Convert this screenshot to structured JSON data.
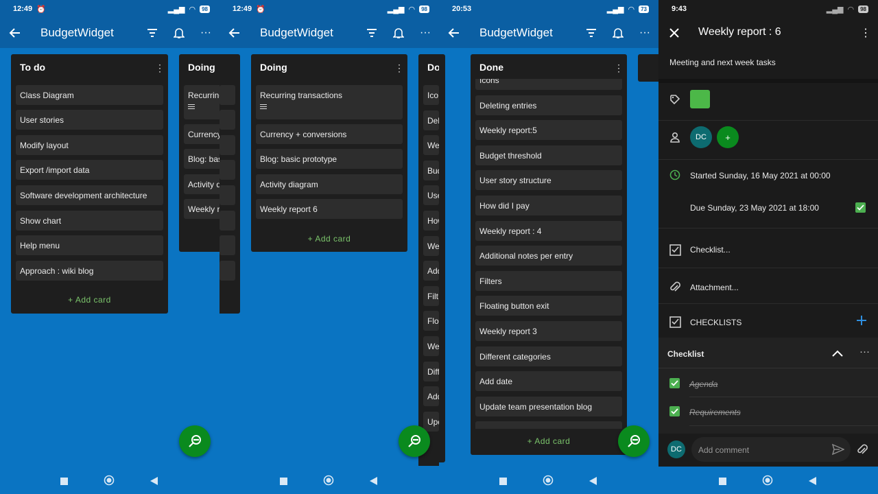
{
  "screens": [
    {
      "status": {
        "time": "12:49",
        "battery": "98"
      },
      "app_title": "BudgetWidget",
      "lists": {
        "todo": {
          "title": "To do",
          "cards": [
            "Class Diagram",
            "User stories",
            "Modify layout",
            "Export /import data",
            "Software development architecture",
            "Show chart",
            "Help menu",
            "Approach : wiki blog"
          ],
          "add_label": "+ Add card"
        },
        "doing_peek": {
          "title": "Doing",
          "cards": [
            "Recurring",
            "Currency",
            "Blog: bas",
            "Activity d",
            "Weekly re"
          ]
        }
      }
    },
    {
      "status": {
        "time": "12:49",
        "battery": "98"
      },
      "app_title": "BudgetWidget",
      "lists": {
        "doing": {
          "title": "Doing",
          "cards": [
            "Recurring transactions",
            "Currency + conversions",
            "Blog: basic prototype",
            "Activity diagram",
            "Weekly report 6"
          ],
          "add_label": "+ Add card"
        },
        "done_peek": {
          "title": "Do",
          "cards": [
            "Ico",
            "Del",
            "We",
            "Bud",
            "Use",
            "How",
            "We",
            "Add",
            "Filt",
            "Flo",
            "We",
            "Diff",
            "Add",
            "Upd"
          ]
        }
      }
    },
    {
      "status": {
        "time": "20:53",
        "battery": "73"
      },
      "app_title": "BudgetWidget",
      "lists": {
        "done": {
          "title": "Done",
          "cards": [
            "Icons",
            "Deleting entries",
            "Weekly report:5",
            "Budget threshold",
            "User story structure",
            "How did I pay",
            "Weekly report : 4",
            "Additional notes per entry",
            "Filters",
            "Floating button exit",
            "Weekly report 3",
            "Different categories",
            "Add date",
            "Update team presentation blog"
          ],
          "add_label": "+ Add card"
        }
      }
    },
    {
      "status": {
        "time": "9:43",
        "battery": "98"
      },
      "title": "Weekly report : 6",
      "description": "Meeting and next week tasks",
      "label_color": "#4CB848",
      "members": [
        "DC"
      ],
      "add_member": "+",
      "started": "Started Sunday, 16 May 2021 at 00:00",
      "due": "Due Sunday, 23 May 2021 at 18:00",
      "checklist_action": "Checklist...",
      "attachment_action": "Attachment...",
      "checklists_header": "CHECKLISTS",
      "checklist": {
        "name": "Checklist",
        "items": [
          "Agenda",
          "Requirements"
        ]
      },
      "comment": {
        "avatar": "DC",
        "placeholder": "Add comment"
      }
    }
  ],
  "colors": {
    "background": "#0A74C2",
    "bar": "#0B5FA3",
    "list": "#1e1e1e",
    "card": "#2d2d2d",
    "accent_green": "#7bc46b",
    "fab": "#0a8a1e"
  }
}
